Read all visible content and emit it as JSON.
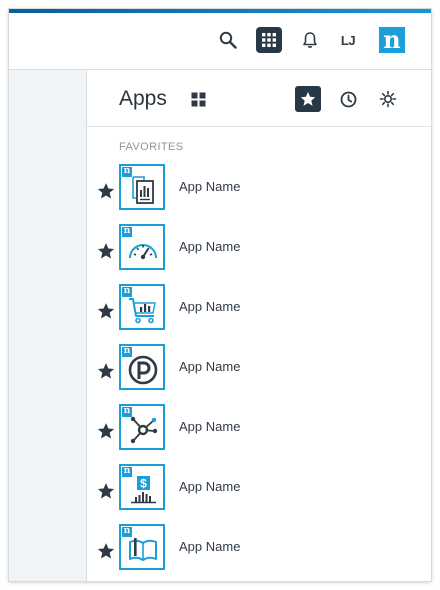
{
  "topbar": {
    "initials": "LJ",
    "logo_letter": "n",
    "icons": [
      "search-icon",
      "apps-grid-icon",
      "bell-icon",
      "user-initials",
      "nintex-logo"
    ]
  },
  "panel": {
    "title": "Apps",
    "section_label": "FAVORITES"
  },
  "colors": {
    "brand_blue": "#1a9fd8",
    "dark_navy": "#293846",
    "text": "#2f3a45",
    "muted": "#8b96a1"
  },
  "apps": [
    {
      "name": "App Name",
      "icon": "documents-chart-icon",
      "favorite": true
    },
    {
      "name": "App Name",
      "icon": "speedometer-icon",
      "favorite": true
    },
    {
      "name": "App Name",
      "icon": "shopping-cart-chart-icon",
      "favorite": true
    },
    {
      "name": "App Name",
      "icon": "p-logo-icon",
      "favorite": true
    },
    {
      "name": "App Name",
      "icon": "hub-nodes-icon",
      "favorite": true
    },
    {
      "name": "App Name",
      "icon": "dollar-chart-icon",
      "favorite": true
    },
    {
      "name": "App Name",
      "icon": "open-book-icon",
      "favorite": true
    }
  ]
}
